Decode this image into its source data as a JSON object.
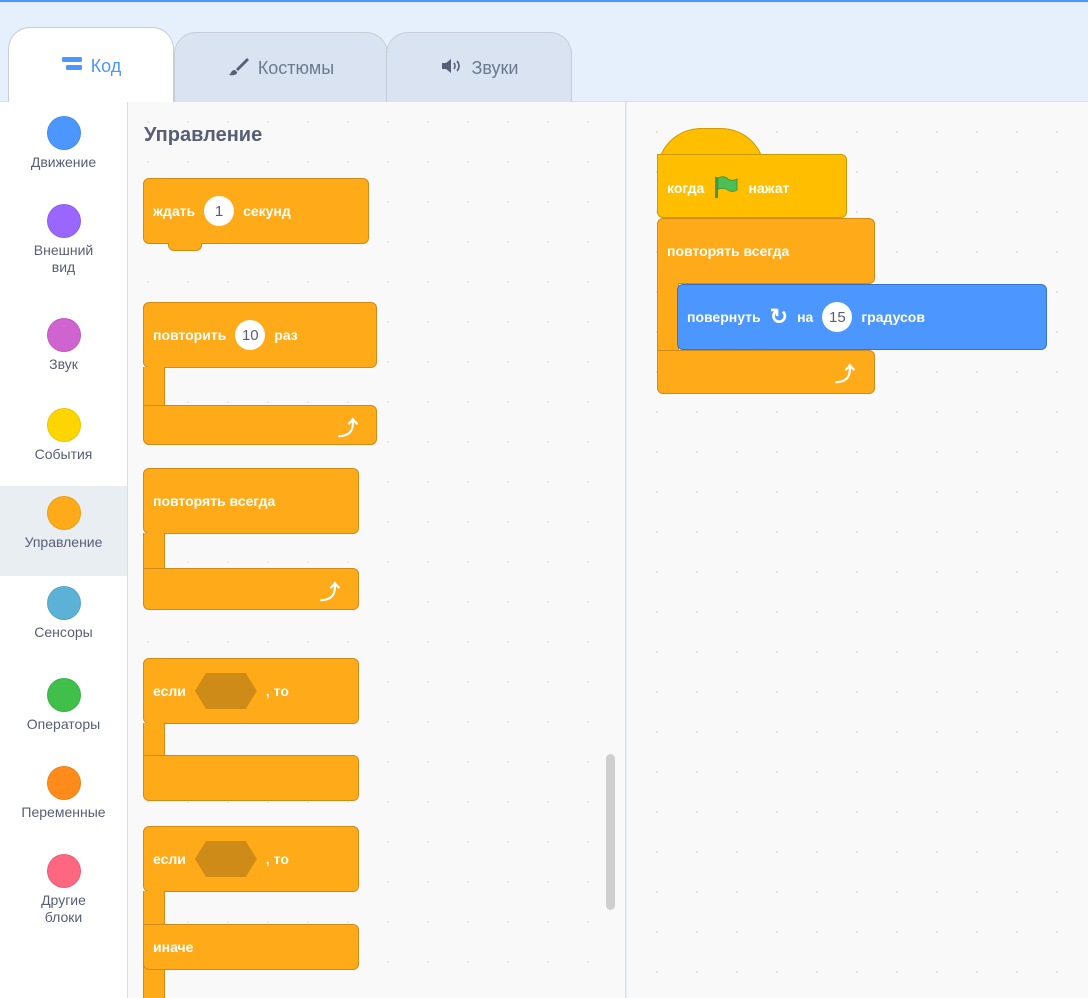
{
  "tabs": [
    {
      "label": "Код",
      "icon": "code-icon",
      "active": true
    },
    {
      "label": "Костюмы",
      "icon": "brush-icon",
      "active": false
    },
    {
      "label": "Звуки",
      "icon": "speaker-icon",
      "active": false
    }
  ],
  "categories": [
    {
      "label": "Движение",
      "color": "#4c97ff"
    },
    {
      "label": "Внешний\nвид",
      "color": "#9966ff"
    },
    {
      "label": "Звук",
      "color": "#cf63cf"
    },
    {
      "label": "События",
      "color": "#ffd500"
    },
    {
      "label": "Управление",
      "color": "#ffab19",
      "selected": true
    },
    {
      "label": "Сенсоры",
      "color": "#5cb1d6"
    },
    {
      "label": "Операторы",
      "color": "#40bf4a"
    },
    {
      "label": "Переменные",
      "color": "#ff8c1a"
    },
    {
      "label": "Другие\nблоки",
      "color": "#ff6680"
    }
  ],
  "palette": {
    "title": "Управление",
    "wait": {
      "label": "ждать",
      "value": "1",
      "unit": "секунд"
    },
    "repeat": {
      "label": "повторить",
      "value": "10",
      "unit": "раз"
    },
    "forever": {
      "label": "повторять всегда"
    },
    "if_then": {
      "label": "если",
      "then": ", то"
    },
    "if_else": {
      "label": "если",
      "then": ", то",
      "else": "иначе"
    }
  },
  "workspace": {
    "hat": {
      "label": "когда",
      "after": "нажат",
      "icon": "green-flag-icon"
    },
    "forever": {
      "label": "повторять всегда"
    },
    "turn": {
      "label": "повернуть",
      "on": "на",
      "value": "15",
      "unit": "градусов",
      "icon": "rotate-right-icon"
    }
  },
  "colors": {
    "control": "#ffab19",
    "events": "#ffbf00",
    "motion": "#4c97ff",
    "accent": "#4c97ff"
  }
}
